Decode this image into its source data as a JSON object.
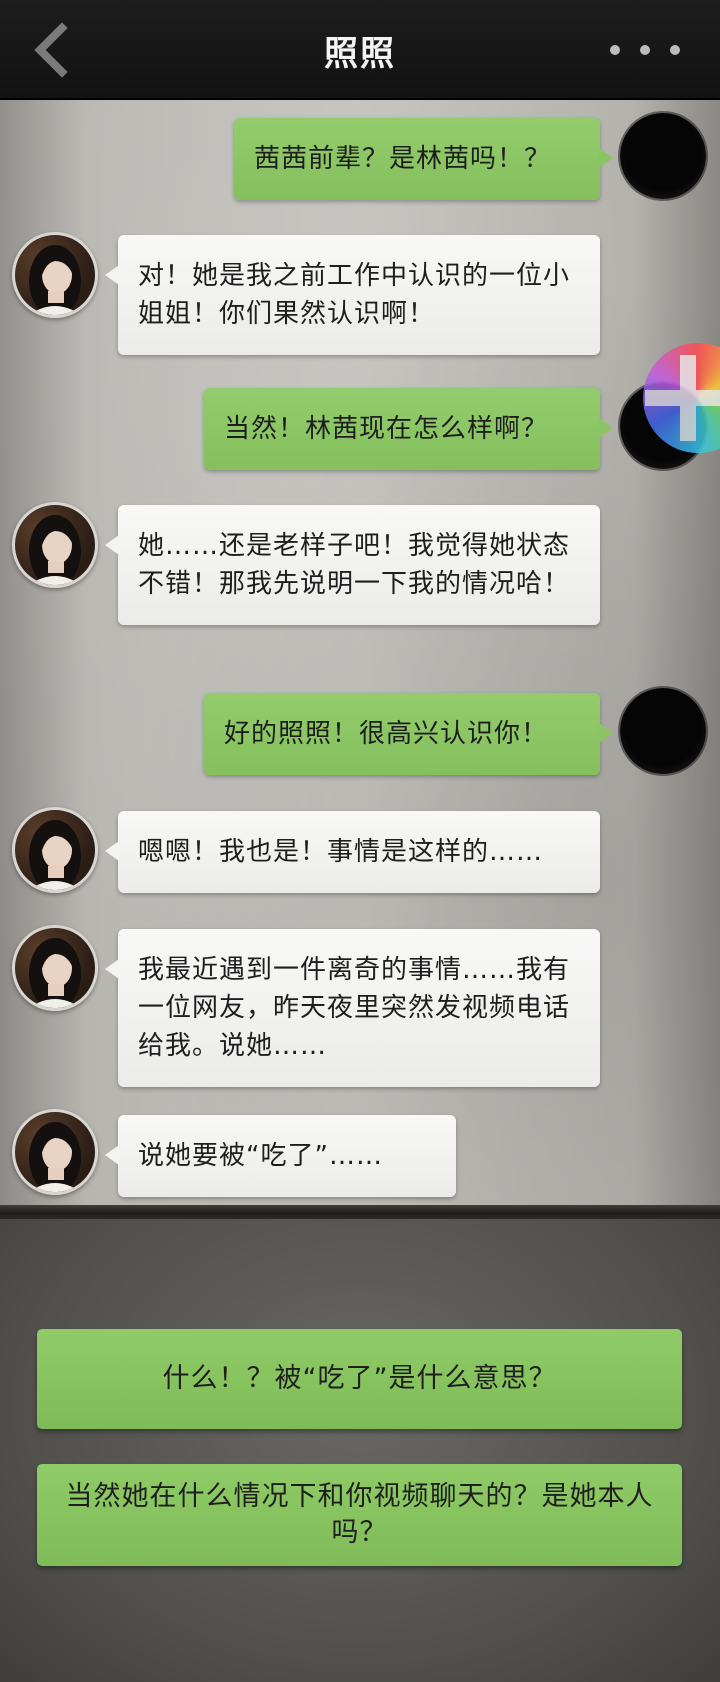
{
  "header": {
    "title": "照照",
    "back_icon": "chevron-left-icon",
    "more_icon": "more-dots-icon"
  },
  "messages": [
    {
      "sender": "me",
      "text": "茜茜前辈？是林茜吗！？"
    },
    {
      "sender": "her",
      "text": "对！她是我之前工作中认识的一位小姐姐！你们果然认识啊！"
    },
    {
      "sender": "me",
      "text": "当然！林茜现在怎么样啊？"
    },
    {
      "sender": "her",
      "text": "她……还是老样子吧！我觉得她状态不错！那我先说明一下我的情况哈！"
    },
    {
      "sender": "me",
      "text": "好的照照！很高兴认识你！"
    },
    {
      "sender": "her",
      "text": "嗯嗯！我也是！事情是这样的……"
    },
    {
      "sender": "her",
      "text": "我最近遇到一件离奇的事情……我有一位网友，昨天夜里突然发视频电话给我。说她……"
    },
    {
      "sender": "her",
      "text": "说她要被“吃了”……"
    }
  ],
  "floating_button": {
    "icon": "gamepad-icon"
  },
  "options": [
    {
      "text": "什么！？被“吃了”是什么意思？"
    },
    {
      "text": "当然她在什么情况下和你视频聊天的？是她本人吗？"
    }
  ],
  "colors": {
    "header_bg": "#161616",
    "outgoing_bubble": "#8bc563",
    "incoming_bubble": "#f3f3f2",
    "option_button": "#86c25d"
  }
}
